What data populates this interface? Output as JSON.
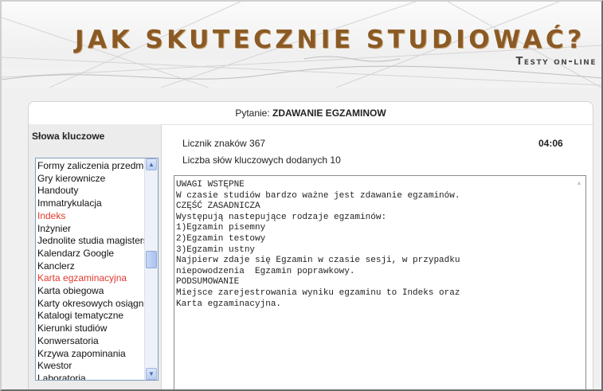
{
  "header": {
    "title": "JAK SKUTECZNIE STUDIOWAĆ?",
    "subtitle": "Testy on-line"
  },
  "question": {
    "label": "Pytanie:",
    "value": "ZDAWANIE EGZAMINOW"
  },
  "keywords": {
    "heading": "Słowa kluczowe",
    "items": [
      {
        "label": "Formy zaliczenia przedmiotów",
        "highlighted": false
      },
      {
        "label": "Gry kierownicze",
        "highlighted": false
      },
      {
        "label": "Handouty",
        "highlighted": false
      },
      {
        "label": "Immatrykulacja",
        "highlighted": false
      },
      {
        "label": "Indeks",
        "highlighted": true
      },
      {
        "label": "Inżynier",
        "highlighted": false
      },
      {
        "label": "Jednolite studia magisterskie",
        "highlighted": false
      },
      {
        "label": "Kalendarz Google",
        "highlighted": false
      },
      {
        "label": "Kanclerz",
        "highlighted": false
      },
      {
        "label": "Karta egzaminacyjna",
        "highlighted": true
      },
      {
        "label": "Karta obiegowa",
        "highlighted": false
      },
      {
        "label": "Karty okresowych osiągnięć",
        "highlighted": false
      },
      {
        "label": "Katalogi tematyczne",
        "highlighted": false
      },
      {
        "label": "Kierunki studiów",
        "highlighted": false
      },
      {
        "label": "Konwersatoria",
        "highlighted": false
      },
      {
        "label": "Krzywa zapominania",
        "highlighted": false
      },
      {
        "label": "Kwestor",
        "highlighted": false
      },
      {
        "label": "Laboratoria",
        "highlighted": false
      }
    ],
    "scroll_up_icon": "arrow-up-icon",
    "scroll_down_icon": "arrow-down-icon"
  },
  "stats": {
    "char_count_text": "Licznik znaków 367",
    "keyword_count_text": "Liczba słów kluczowych dodanych 10",
    "timer": "04:06"
  },
  "editor": {
    "text": "UWAGI WSTĘPNE\nW czasie studiów bardzo ważne jest zdawanie egzaminów.\nCZĘŚĆ ZASADNICZA\nWystępują nastepujące rodzaje egzaminów:\n1)Egzamin pisemny\n2)Egzamin testowy\n3)Egzamin ustny\nNajpierw zdaje się Egzamin w czasie sesji, w przypadku\nniepowodzenia  Egzamin poprawkowy.\nPODSUMOWANIE\nMiejsce zarejestrowania wyniku egzaminu to Indeks oraz\nKarta egzaminacyjna."
  },
  "colors": {
    "title": "#8b5a24",
    "highlight": "#e03a2f",
    "background": "#f0f0f0"
  }
}
